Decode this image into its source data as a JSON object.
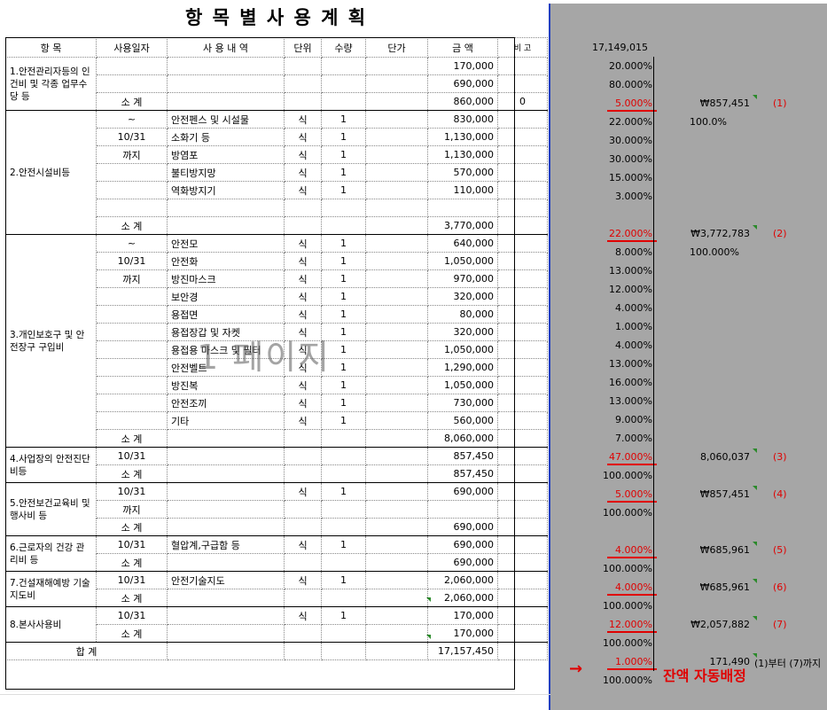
{
  "title": "항 목 별 사 용 계 획",
  "headers": [
    "항 목",
    "사용일자",
    "사 용 내 역",
    "단위",
    "수량",
    "단가",
    "금 액",
    "비 고"
  ],
  "grand_total_label": "합 계",
  "grand_total_amount": "17,157,450",
  "grand_total_pct": "100.000%",
  "top_value": "17,149,015",
  "watermark": "1 페이지",
  "note": "잔액 자동배정",
  "note_arrow": "→",
  "sections": [
    {
      "category": "1.안전관리자등의 인건비 및 각종 업무수당 등",
      "rows": [
        {
          "date": "",
          "item": "",
          "unit": "",
          "qty": "",
          "price": "",
          "amount": "170,000",
          "remark": "",
          "pct": "20.000%"
        },
        {
          "date": "",
          "item": "",
          "unit": "",
          "qty": "",
          "price": "",
          "amount": "690,000",
          "remark": "",
          "pct": "80.000%"
        }
      ],
      "subtotal": {
        "label": "소 계",
        "amount": "860,000",
        "remark": "0",
        "pct": "5.000%",
        "alloc": "₩857,451",
        "tag": "(1)",
        "extra": ""
      }
    },
    {
      "category": "2.안전시설비등",
      "rows": [
        {
          "date": "~",
          "item": "안전펜스 및 시설물",
          "unit": "식",
          "qty": "1",
          "price": "",
          "amount": "830,000",
          "remark": "",
          "pct": "22.000%"
        },
        {
          "date": "10/31",
          "item": "소화기 등",
          "unit": "식",
          "qty": "1",
          "price": "",
          "amount": "1,130,000",
          "remark": "",
          "pct": "30.000%"
        },
        {
          "date": "까지",
          "item": "방염포",
          "unit": "식",
          "qty": "1",
          "price": "",
          "amount": "1,130,000",
          "remark": "",
          "pct": "30.000%"
        },
        {
          "date": "",
          "item": "불티방지망",
          "unit": "식",
          "qty": "1",
          "price": "",
          "amount": "570,000",
          "remark": "",
          "pct": "15.000%"
        },
        {
          "date": "",
          "item": "역화방지기",
          "unit": "식",
          "qty": "1",
          "price": "",
          "amount": "110,000",
          "remark": "",
          "pct": "3.000%"
        },
        {
          "date": "",
          "item": "",
          "unit": "",
          "qty": "",
          "price": "",
          "amount": "",
          "remark": "",
          "pct": ""
        }
      ],
      "side_total": "100.0%",
      "subtotal": {
        "label": "소 계",
        "amount": "3,770,000",
        "remark": "",
        "pct": "22.000%",
        "alloc": "₩3,772,783",
        "tag": "(2)",
        "extra": ""
      }
    },
    {
      "category": "3.개인보호구 및 안전장구 구입비",
      "rows": [
        {
          "date": "~",
          "item": "안전모",
          "unit": "식",
          "qty": "1",
          "price": "",
          "amount": "640,000",
          "remark": "",
          "pct": "8.000%"
        },
        {
          "date": "10/31",
          "item": "안전화",
          "unit": "식",
          "qty": "1",
          "price": "",
          "amount": "1,050,000",
          "remark": "",
          "pct": "13.000%"
        },
        {
          "date": "까지",
          "item": "방진마스크",
          "unit": "식",
          "qty": "1",
          "price": "",
          "amount": "970,000",
          "remark": "",
          "pct": "12.000%"
        },
        {
          "date": "",
          "item": "보안경",
          "unit": "식",
          "qty": "1",
          "price": "",
          "amount": "320,000",
          "remark": "",
          "pct": "4.000%"
        },
        {
          "date": "",
          "item": "용접면",
          "unit": "식",
          "qty": "1",
          "price": "",
          "amount": "80,000",
          "remark": "",
          "pct": "1.000%"
        },
        {
          "date": "",
          "item": "용접장갑 및 자켓",
          "unit": "식",
          "qty": "1",
          "price": "",
          "amount": "320,000",
          "remark": "",
          "pct": "4.000%"
        },
        {
          "date": "",
          "item": "용접용 마스크 및 필터",
          "unit": "식",
          "qty": "1",
          "price": "",
          "amount": "1,050,000",
          "remark": "",
          "pct": "13.000%"
        },
        {
          "date": "",
          "item": "안전벨트",
          "unit": "식",
          "qty": "1",
          "price": "",
          "amount": "1,290,000",
          "remark": "",
          "pct": "16.000%"
        },
        {
          "date": "",
          "item": "방진복",
          "unit": "식",
          "qty": "1",
          "price": "",
          "amount": "1,050,000",
          "remark": "",
          "pct": "13.000%"
        },
        {
          "date": "",
          "item": "안전조끼",
          "unit": "식",
          "qty": "1",
          "price": "",
          "amount": "730,000",
          "remark": "",
          "pct": "9.000%"
        },
        {
          "date": "",
          "item": "기타",
          "unit": "식",
          "qty": "1",
          "price": "",
          "amount": "560,000",
          "remark": "",
          "pct": "7.000%"
        }
      ],
      "side_total": "100.000%",
      "subtotal": {
        "label": "소 계",
        "amount": "8,060,000",
        "remark": "",
        "pct": "47.000%",
        "alloc": "8,060,037",
        "tag": "(3)",
        "extra": ""
      }
    },
    {
      "category": "4.사업장의 안전진단비등",
      "rows": [
        {
          "date": "10/31",
          "item": "",
          "unit": "",
          "qty": "",
          "price": "",
          "amount": "857,450",
          "remark": "",
          "pct": "100.000%"
        }
      ],
      "subtotal": {
        "label": "소 계",
        "amount": "857,450",
        "remark": "",
        "pct": "5.000%",
        "alloc": "₩857,451",
        "tag": "(4)",
        "extra": ""
      }
    },
    {
      "category": "5.안전보건교육비 및 행사비 등",
      "rows": [
        {
          "date": "10/31",
          "item": "",
          "unit": "식",
          "qty": "1",
          "price": "",
          "amount": "690,000",
          "remark": "",
          "pct": "100.000%"
        },
        {
          "date": "까지",
          "item": "",
          "unit": "",
          "qty": "",
          "price": "",
          "amount": "",
          "remark": "",
          "pct": ""
        }
      ],
      "subtotal": {
        "label": "소 계",
        "amount": "690,000",
        "remark": "",
        "pct": "4.000%",
        "alloc": "₩685,961",
        "tag": "(5)",
        "extra": ""
      }
    },
    {
      "category": "6.근로자의 건강 관리비 등",
      "rows": [
        {
          "date": "10/31",
          "item": "혈압계,구급함 등",
          "unit": "식",
          "qty": "1",
          "price": "",
          "amount": "690,000",
          "remark": "",
          "pct": "100.000%"
        }
      ],
      "subtotal": {
        "label": "소 계",
        "amount": "690,000",
        "remark": "",
        "pct": "4.000%",
        "alloc": "₩685,961",
        "tag": "(6)",
        "extra": ""
      }
    },
    {
      "category": "7.건설재해예방 기술지도비",
      "rows": [
        {
          "date": "10/31",
          "item": "안전기술지도",
          "unit": "식",
          "qty": "1",
          "price": "",
          "amount": "2,060,000",
          "remark": "",
          "pct": "100.000%"
        }
      ],
      "subtotal": {
        "label": "소 계",
        "amount": "2,060,000",
        "remark": "",
        "pct": "12.000%",
        "alloc": "₩2,057,882",
        "tag": "(7)",
        "extra": ""
      }
    },
    {
      "category": "8.본사사용비",
      "rows": [
        {
          "date": "10/31",
          "item": "",
          "unit": "식",
          "qty": "1",
          "price": "",
          "amount": "170,000",
          "remark": "",
          "pct": "100.000%"
        }
      ],
      "subtotal": {
        "label": "소 계",
        "amount": "170,000",
        "remark": "",
        "pct": "1.000%",
        "alloc": "171,490",
        "tag": "",
        "extra": "(1)부터 (7)까지"
      }
    }
  ],
  "colors": {
    "red": "#e00000",
    "gray_panel": "#a6a6a6",
    "blue_border": "#1f3fbf",
    "green_marker": "#2a8a2a"
  }
}
